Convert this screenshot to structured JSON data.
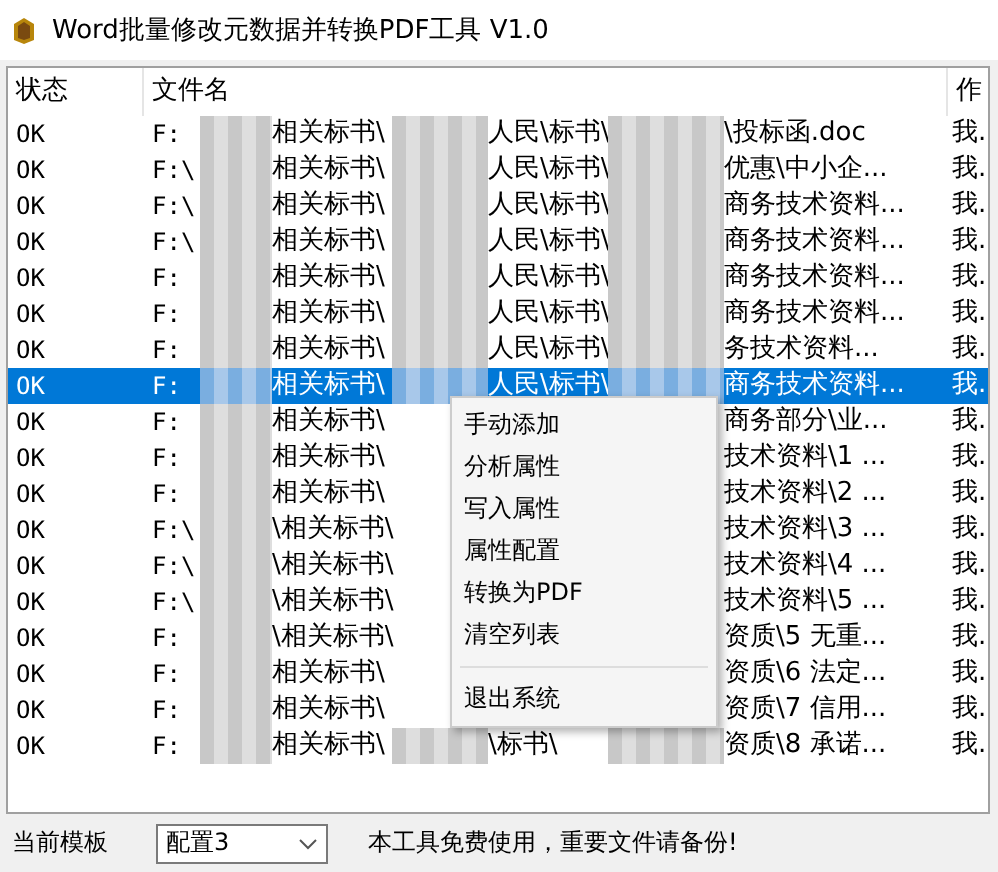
{
  "window": {
    "title": "Word批量修改元数据并转换PDF工具 V1.0"
  },
  "table": {
    "columns": [
      "状态",
      "文件名",
      "作"
    ],
    "rows": [
      {
        "status": "OK",
        "drive": "F:",
        "folder": "相关标书\\",
        "middle": "人民\\标书\\",
        "tail": "\\投标函.doc",
        "author": "我.",
        "selected": false
      },
      {
        "status": "OK",
        "drive": "F:\\",
        "folder": "相关标书\\",
        "middle": "人民\\标书\\",
        "tail": "优惠\\中小企...",
        "author": "我.",
        "selected": false
      },
      {
        "status": "OK",
        "drive": "F:\\",
        "folder": "相关标书\\",
        "middle": "人民\\标书\\",
        "tail": "商务技术资料...",
        "author": "我.",
        "selected": false
      },
      {
        "status": "OK",
        "drive": "F:\\",
        "folder": "相关标书\\",
        "middle": "人民\\标书\\",
        "tail": "商务技术资料...",
        "author": "我.",
        "selected": false
      },
      {
        "status": "OK",
        "drive": "F:",
        "folder": "相关标书\\",
        "middle": "人民\\标书\\",
        "tail": "商务技术资料...",
        "author": "我.",
        "selected": false
      },
      {
        "status": "OK",
        "drive": "F:",
        "folder": "相关标书\\",
        "middle": "人民\\标书\\",
        "tail": "商务技术资料...",
        "author": "我.",
        "selected": false
      },
      {
        "status": "OK",
        "drive": "F:",
        "folder": "相关标书\\",
        "middle": "人民\\标书\\",
        "tail": "务技术资料...",
        "author": "我.",
        "selected": false
      },
      {
        "status": "OK",
        "drive": "F:",
        "folder": "相关标书\\",
        "middle": "人民\\标书\\",
        "tail": "商务技术资料...",
        "author": "我.",
        "selected": true
      },
      {
        "status": "OK",
        "drive": "F:",
        "folder": "相关标书\\",
        "tail": "商务部分\\业...",
        "author": "我.",
        "selected": false
      },
      {
        "status": "OK",
        "drive": "F:",
        "folder": "相关标书\\",
        "tail": "技术资料\\1 ...",
        "author": "我.",
        "selected": false
      },
      {
        "status": "OK",
        "drive": "F:",
        "folder": "相关标书\\",
        "tail": "技术资料\\2 ...",
        "author": "我.",
        "selected": false
      },
      {
        "status": "OK",
        "drive": "F:\\",
        "folder": "\\相关标书\\",
        "tail": "技术资料\\3 ...",
        "author": "我.",
        "selected": false
      },
      {
        "status": "OK",
        "drive": "F:\\",
        "folder": "\\相关标书\\",
        "tail": "技术资料\\4 ...",
        "author": "我.",
        "selected": false
      },
      {
        "status": "OK",
        "drive": "F:\\",
        "folder": "\\相关标书\\",
        "tail": "技术资料\\5 ...",
        "author": "我.",
        "selected": false
      },
      {
        "status": "OK",
        "drive": "F:",
        "folder": "\\相关标书\\",
        "tail": "资质\\5 无重...",
        "author": "我.",
        "selected": false
      },
      {
        "status": "OK",
        "drive": "F:",
        "folder": "相关标书\\",
        "tail": "资质\\6 法定...",
        "author": "我.",
        "selected": false
      },
      {
        "status": "OK",
        "drive": "F:",
        "folder": "相关标书\\",
        "tail": "资质\\7 信用...",
        "author": "我.",
        "selected": false
      },
      {
        "status": "OK",
        "drive": "F:",
        "folder": "相关标书\\",
        "middle": "\\标书\\",
        "tail": "资质\\8  承诺...",
        "author": "我.",
        "selected": false
      }
    ]
  },
  "context_menu": {
    "items": [
      "手动添加",
      "分析属性",
      "写入属性",
      "属性配置",
      "转换为PDF",
      "清空列表"
    ],
    "exit_item": "退出系统"
  },
  "status_bar": {
    "label": "当前模板",
    "template": "配置3",
    "notice": "本工具免费使用，重要文件请备份!"
  }
}
